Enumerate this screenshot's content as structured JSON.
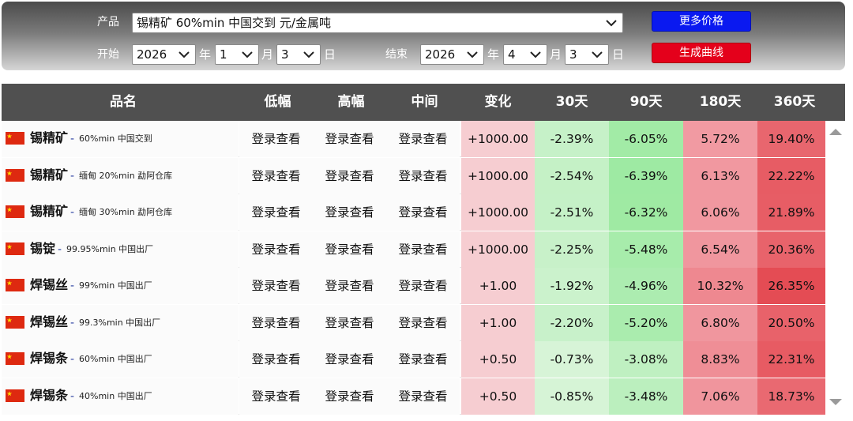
{
  "controls": {
    "product_label": "产品",
    "product_value": "锡精矿 60%min 中国交到 元/金属吨",
    "start_label": "开始",
    "end_label": "结束",
    "start": {
      "year": "2026",
      "month": "1",
      "day": "3"
    },
    "end": {
      "year": "2026",
      "month": "4",
      "day": "3"
    },
    "unit_year": "年",
    "unit_month": "月",
    "unit_day": "日",
    "more_prices_button": "更多价格",
    "generate_curve_button": "生成曲线"
  },
  "table": {
    "headers": [
      "品名",
      "低幅",
      "高幅",
      "中间",
      "变化",
      "30天",
      "90天",
      "180天",
      "360天"
    ],
    "login_text": "登录查看",
    "rows": [
      {
        "name": "锡精矿",
        "sep": "-",
        "desc": "60%min 中国交到",
        "change": "+1000.00",
        "d30": "-2.39%",
        "d90": "-6.05%",
        "d180": "5.72%",
        "d360": "19.40%"
      },
      {
        "name": "锡精矿",
        "sep": "-",
        "desc": "缅甸 20%min 勐阿仓库",
        "change": "+1000.00",
        "d30": "-2.54%",
        "d90": "-6.39%",
        "d180": "6.13%",
        "d360": "22.22%"
      },
      {
        "name": "锡精矿",
        "sep": "-",
        "desc": "缅甸 30%min 勐阿仓库",
        "change": "+1000.00",
        "d30": "-2.51%",
        "d90": "-6.32%",
        "d180": "6.06%",
        "d360": "21.89%"
      },
      {
        "name": "锡锭",
        "sep": "-",
        "desc": "99.95%min 中国出厂",
        "change": "+1000.00",
        "d30": "-2.25%",
        "d90": "-5.48%",
        "d180": "6.54%",
        "d360": "20.36%"
      },
      {
        "name": "焊锡丝",
        "sep": "-",
        "desc": "99%min 中国出厂",
        "change": "+1.00",
        "d30": "-1.92%",
        "d90": "-4.96%",
        "d180": "10.32%",
        "d360": "26.35%"
      },
      {
        "name": "焊锡丝",
        "sep": "-",
        "desc": "99.3%min 中国出厂",
        "change": "+1.00",
        "d30": "-2.20%",
        "d90": "-5.20%",
        "d180": "6.80%",
        "d360": "20.50%"
      },
      {
        "name": "焊锡条",
        "sep": "-",
        "desc": "60%min 中国出厂",
        "change": "+0.50",
        "d30": "-0.73%",
        "d90": "-3.08%",
        "d180": "8.83%",
        "d360": "22.31%"
      },
      {
        "name": "焊锡条",
        "sep": "-",
        "desc": "40%min 中国出厂",
        "change": "+0.50",
        "d30": "-0.85%",
        "d90": "-3.48%",
        "d180": "7.06%",
        "d360": "18.73%"
      }
    ]
  },
  "colors": {
    "header_bg": "#505050",
    "change_bg": "#f6cdd1",
    "btn_blue": "#0a19f0",
    "btn_red": "#e4001b"
  },
  "icons": {
    "flag": "china-flag-icon",
    "dropdown": "chevron-down-icon",
    "scroll_up": "scroll-up-arrow-icon",
    "scroll_down": "scroll-down-arrow-icon"
  }
}
